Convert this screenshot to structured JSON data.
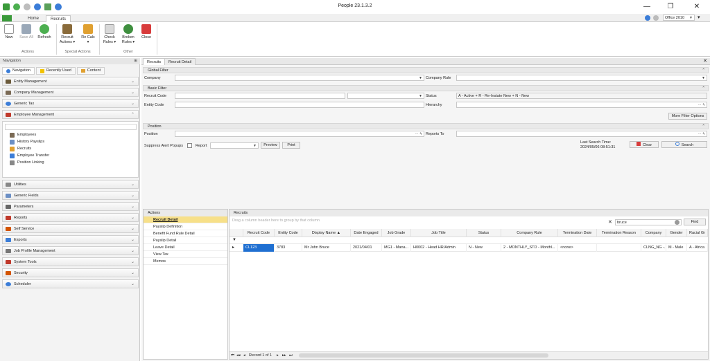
{
  "window": {
    "title": "People 23.1.3.2",
    "minimize": "—",
    "maximize": "❐",
    "close": "✕"
  },
  "ribbon_tabs": [
    "Home",
    "Recruits"
  ],
  "theme": {
    "label": "Office 2010"
  },
  "ribbon": {
    "new": "New",
    "save_all": "Save All",
    "refresh": "Refresh",
    "group_actions": "Actions",
    "recruit_actions": "Recruit Actions",
    "recalc": "Re Calc",
    "group_special": "Special Actions",
    "check_rules": "Check Rules",
    "broken_rules": "Broken Rules",
    "close": "Close",
    "group_other": "Other"
  },
  "nav": {
    "header": "Navigation",
    "tabs": [
      "Navigation",
      "Recently Used",
      "Content"
    ],
    "sections_top": [
      "Entity Management",
      "Company Management",
      "Generic Tax",
      "Employee Management"
    ],
    "items": [
      "Employees",
      "History Payslips",
      "Recruits",
      "Employee Transfer",
      "Position Linking"
    ],
    "sections_bottom": [
      "Utilities",
      "Generic Fields",
      "Parameters",
      "Reports",
      "Self Service",
      "Exports",
      "Job Profile Management",
      "System Tools",
      "Security",
      "Scheduler"
    ]
  },
  "doc_tabs": [
    "Recruits",
    "Recruit Detail"
  ],
  "filters": {
    "global": "Global Filter",
    "company_label": "Company",
    "company_rule_label": "Company Rule",
    "basic": "Basic Filter",
    "recruit_code_label": "Recruit Code",
    "status_label": "Status",
    "status_value": "A - Active + R - Re-Instate New + N - New",
    "entity_code_label": "Entity Code",
    "hierarchy_label": "Hierarchy",
    "more_filter": "More Filter Options",
    "position_bar": "Position",
    "position_label": "Position",
    "reports_to_label": "Reports To",
    "suppress": "Suppress Alert Popups",
    "report_label": "Report",
    "preview": "Preview",
    "print": "Print",
    "last_search_label": "Last Search Time:",
    "last_search_value": "2024/05/06 08:51:31",
    "clear": "Clear",
    "search": "Search"
  },
  "actions": {
    "title": "Actions",
    "items": [
      "Recruit Detail",
      "Payslip Definition",
      "Benefit Fund Rule Detail",
      "Payslip Detail",
      "Leave Detail",
      "View Tax",
      "Memos"
    ]
  },
  "grid": {
    "title": "Recruits",
    "group_hint": "Drag a column header here to group by that column",
    "find_value": "bruce",
    "find_button": "Find",
    "columns": [
      "Recruit Code",
      "Entity Code",
      "Display Name",
      "Date Engaged",
      "Job Grade",
      "Job Title",
      "Status",
      "Company Rule",
      "Termination Date",
      "Termination Reason",
      "Company",
      "Gender",
      "Racial Gr"
    ],
    "row": [
      "CL123",
      "3783",
      "Mr John Bruce",
      "2021/04/01",
      "MG1 - Mana...",
      "H0002 - Head HR/Admin",
      "N - New",
      "2 - MONTHLY_STD - Monthl...",
      "<none>",
      "",
      "CLNG_NG -...",
      "M - Male",
      "A - Africa"
    ],
    "footer": "Record 1 of 1"
  }
}
